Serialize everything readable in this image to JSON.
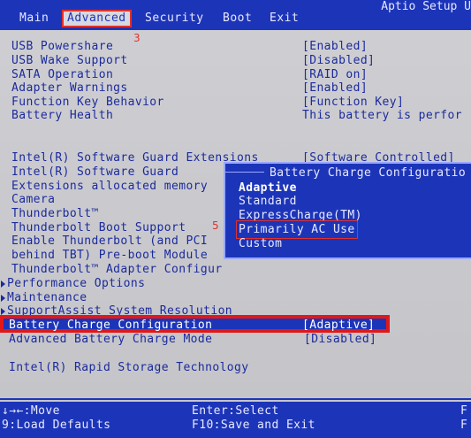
{
  "header": {
    "tabs": [
      "Main",
      "Advanced",
      "Security",
      "Boot",
      "Exit"
    ],
    "active_tab": "Advanced",
    "title": "Aptio Setup U"
  },
  "annotations": {
    "tab_marker": "3",
    "option_marker": "5"
  },
  "settings": [
    {
      "label": "USB Powershare",
      "value": "[Enabled]"
    },
    {
      "label": "USB Wake Support",
      "value": "[Disabled]"
    },
    {
      "label": "SATA Operation",
      "value": "[RAID on]"
    },
    {
      "label": "Adapter Warnings",
      "value": "[Enabled]"
    },
    {
      "label": "Function Key Behavior",
      "value": "[Function Key]"
    },
    {
      "label": "Battery Health",
      "value": "This battery is perfor"
    },
    {
      "label": "Intel(R) Software Guard Extensions",
      "value": "[Software Controlled]"
    },
    {
      "label": "Intel(R) Software Guard",
      "value": ""
    },
    {
      "label": "Extensions allocated memory",
      "value": ""
    },
    {
      "label": "Camera",
      "value": ""
    },
    {
      "label": "Thunderbolt™",
      "value": ""
    },
    {
      "label": "Thunderbolt Boot Support",
      "value": ""
    },
    {
      "label": "Enable Thunderbolt (and PCI",
      "value": ""
    },
    {
      "label": "behind TBT) Pre-boot Module",
      "value": ""
    },
    {
      "label": "Thunderbolt™ Adapter Configur",
      "value": ""
    },
    {
      "label": "Performance Options",
      "value": ""
    },
    {
      "label": "Maintenance",
      "value": ""
    },
    {
      "label": "SupportAssist System Resolution",
      "value": ""
    },
    {
      "label": "Battery Charge Configuration",
      "value": "[Adaptive]"
    },
    {
      "label": "Advanced Battery Charge Mode",
      "value": "[Disabled]"
    },
    {
      "label": "Intel(R) Rapid Storage Technology",
      "value": ""
    }
  ],
  "popup": {
    "title": "Battery Charge Configuratio",
    "options": [
      "Adaptive",
      "Standard",
      "ExpressCharge(TM)",
      "Primarily AC Use",
      "Custom"
    ],
    "selected": "Adaptive"
  },
  "footer": {
    "move": "↓→←:Move",
    "select": "Enter:Select",
    "load_defaults": "9:Load Defaults",
    "save_exit": "F10:Save and Exit",
    "right1": "F",
    "right2": "F"
  },
  "colors": {
    "bar_blue": "#1c35b8",
    "text_blue": "#1b2a9c",
    "highlight_red": "#e0181a",
    "background_gray": "#c8c8cc"
  }
}
